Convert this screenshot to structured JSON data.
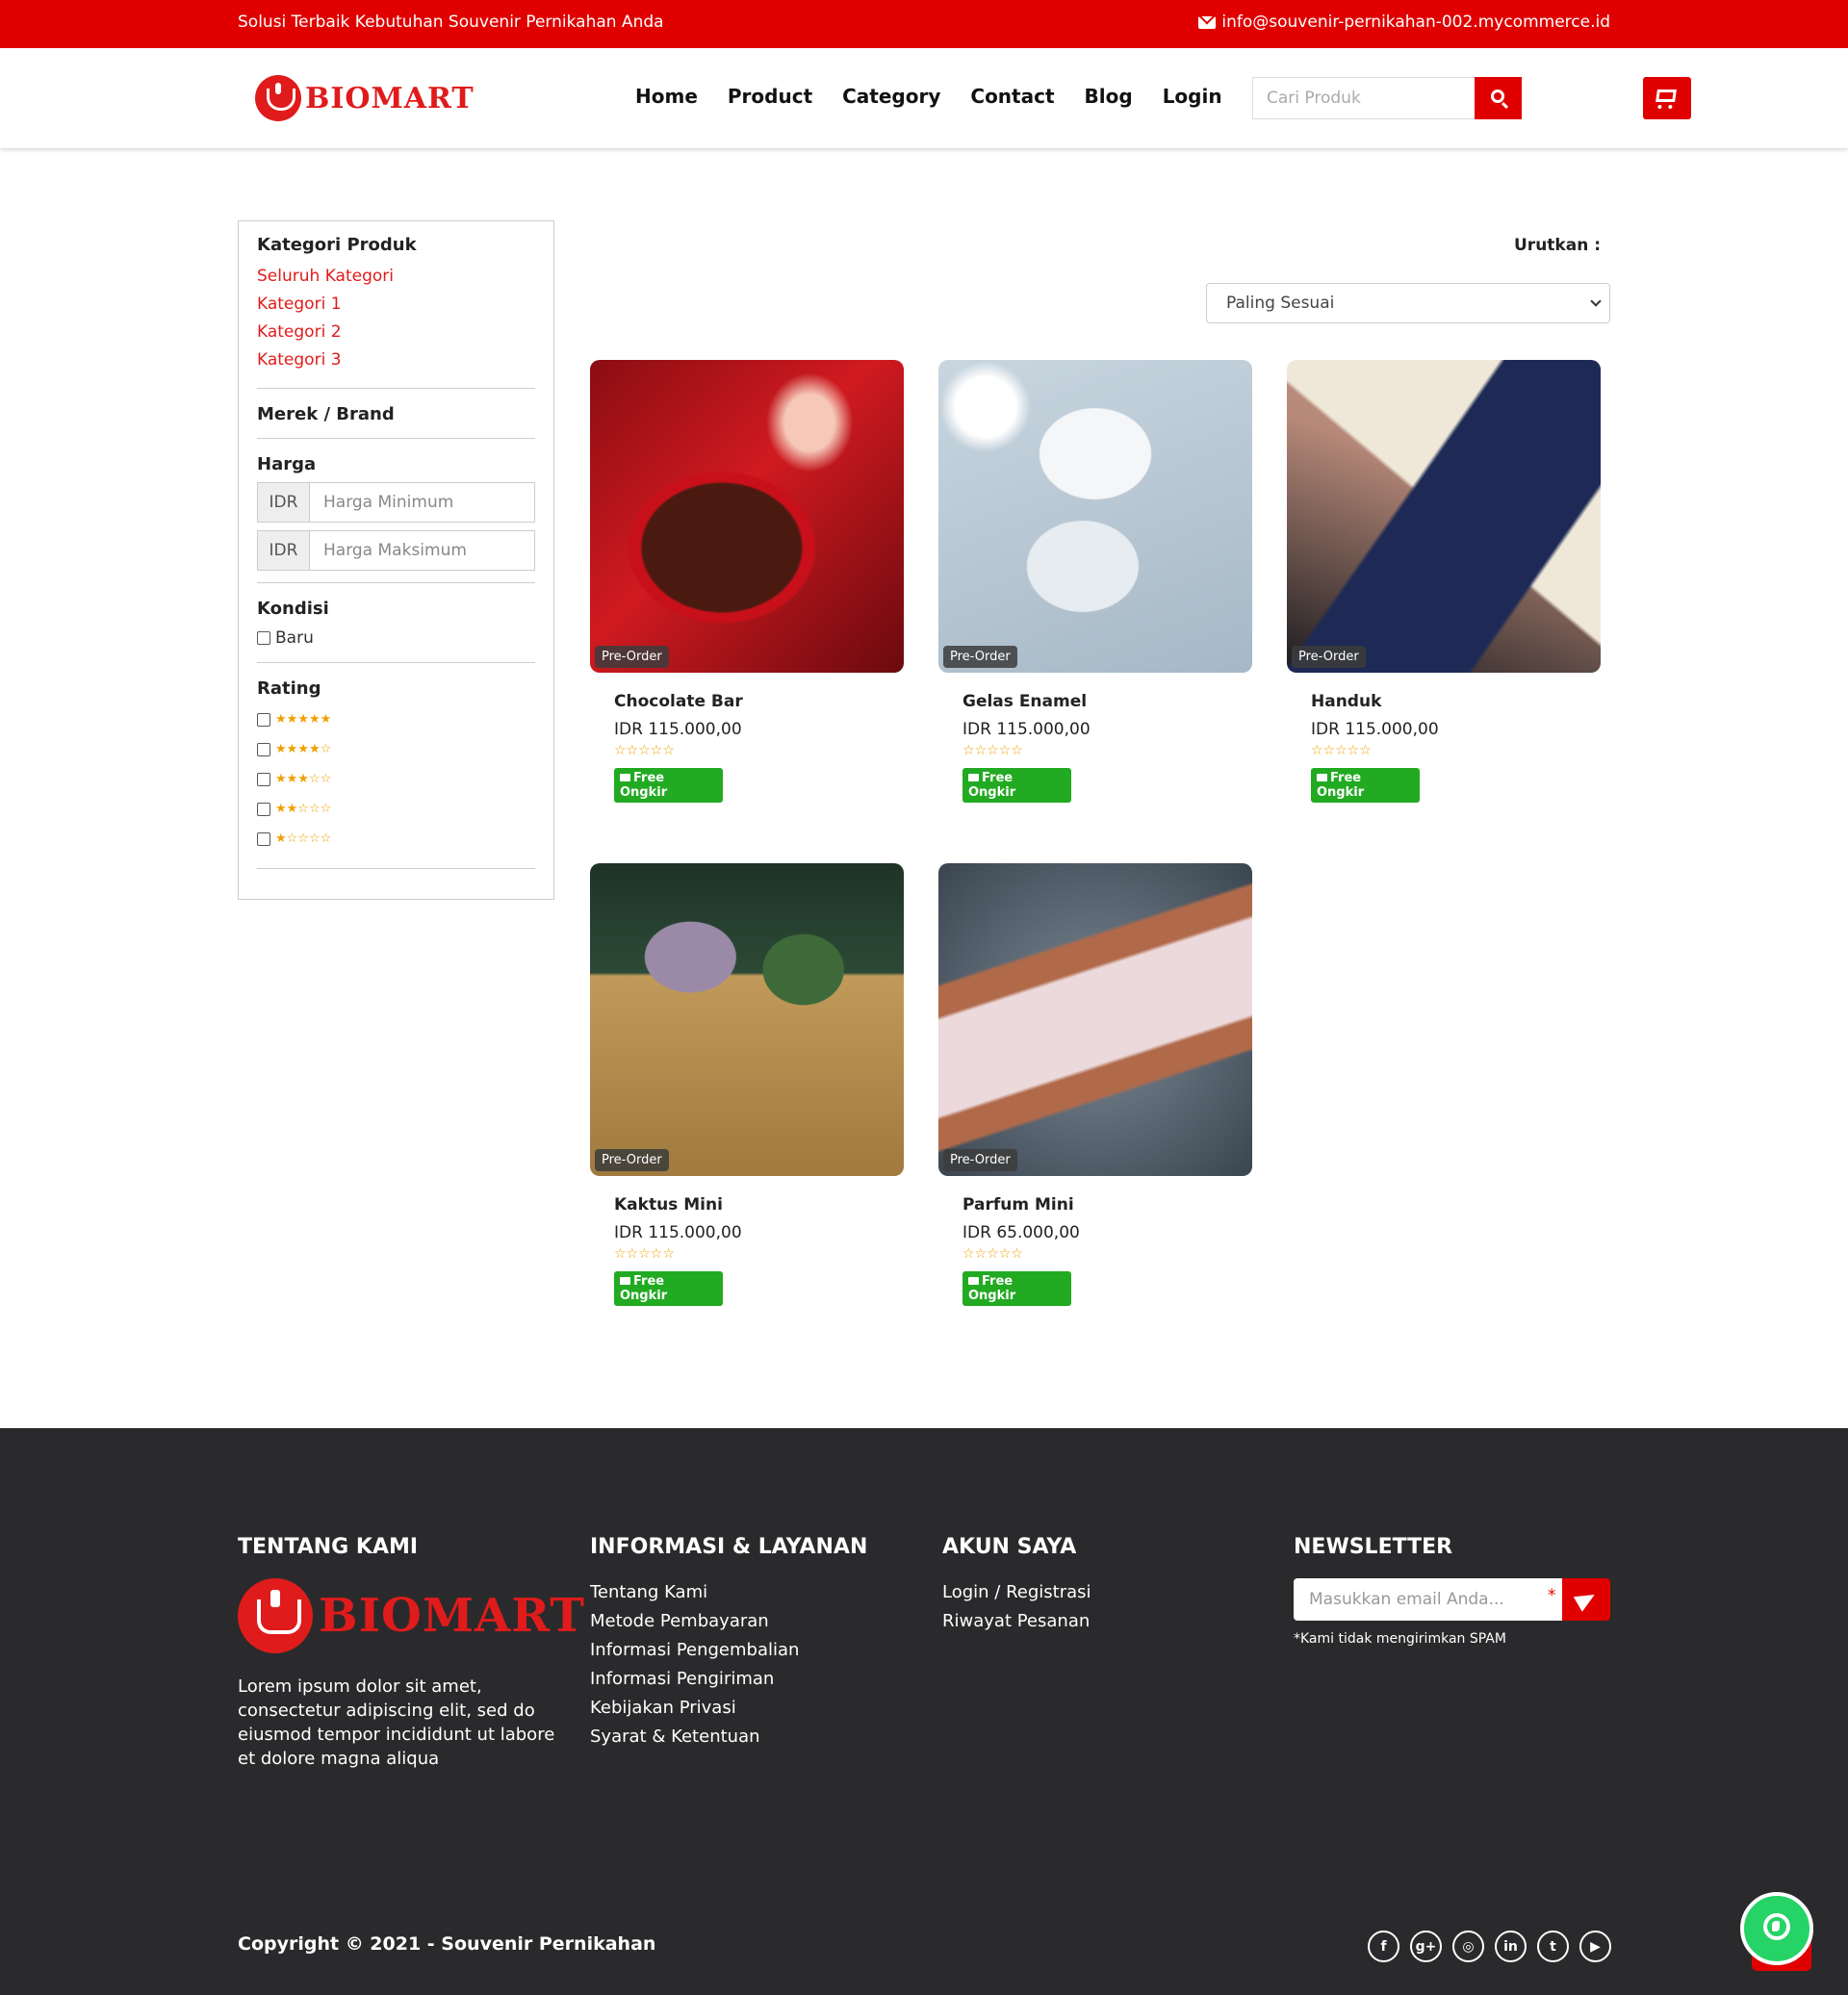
{
  "topbar": {
    "tagline": "Solusi Terbaik Kebutuhan Souvenir Pernikahan Anda",
    "email": "info@souvenir-pernikahan-002.mycommerce.id"
  },
  "header": {
    "logo_text": "BIOMART",
    "nav": [
      "Home",
      "Product",
      "Category",
      "Contact",
      "Blog",
      "Login"
    ],
    "search_placeholder": "Cari Produk"
  },
  "sidebar": {
    "category_title": "Kategori Produk",
    "categories": [
      "Seluruh Kategori",
      "Kategori 1",
      "Kategori 2",
      "Kategori 3"
    ],
    "brand_title": "Merek / Brand",
    "price_title": "Harga",
    "currency": "IDR",
    "price_min_placeholder": "Harga Minimum",
    "price_max_placeholder": "Harga Maksimum",
    "condition_title": "Kondisi",
    "condition_option": "Baru",
    "rating_title": "Rating",
    "rating_options": [
      "★★★★★",
      "★★★★☆",
      "★★★☆☆",
      "★★☆☆☆",
      "★☆☆☆☆"
    ]
  },
  "sort": {
    "label": "Urutkan :",
    "selected": "Paling Sesuai"
  },
  "products": [
    {
      "name": "Chocolate Bar",
      "price": "IDR 115.000,00",
      "rating": "☆☆☆☆☆",
      "badge": "Pre-Order",
      "shipping": "Free Ongkir"
    },
    {
      "name": "Gelas Enamel",
      "price": "IDR 115.000,00",
      "rating": "☆☆☆☆☆",
      "badge": "Pre-Order",
      "shipping": "Free Ongkir"
    },
    {
      "name": "Handuk",
      "price": "IDR 115.000,00",
      "rating": "☆☆☆☆☆",
      "badge": "Pre-Order",
      "shipping": "Free Ongkir"
    },
    {
      "name": "Kaktus Mini",
      "price": "IDR 115.000,00",
      "rating": "☆☆☆☆☆",
      "badge": "Pre-Order",
      "shipping": "Free Ongkir"
    },
    {
      "name": "Parfum Mini",
      "price": "IDR 65.000,00",
      "rating": "☆☆☆☆☆",
      "badge": "Pre-Order",
      "shipping": "Free Ongkir"
    }
  ],
  "footer": {
    "about_title": "TENTANG KAMI",
    "about_text": "Lorem ipsum dolor sit amet, consectetur adipiscing elit, sed do eiusmod tempor incididunt ut labore et dolore magna aliqua",
    "info_title": "INFORMASI & LAYANAN",
    "info_links": [
      "Tentang Kami",
      "Metode Pembayaran",
      "Informasi Pengembalian",
      "Informasi Pengiriman",
      "Kebijakan Privasi",
      "Syarat & Ketentuan"
    ],
    "account_title": "AKUN SAYA",
    "account_links": [
      "Login / Registrasi",
      "Riwayat Pesanan"
    ],
    "newsletter_title": "NEWSLETTER",
    "newsletter_placeholder": "Masukkan email Anda...",
    "newsletter_required": "*",
    "spam_note": "*Kami tidak mengirimkan SPAM",
    "copyright": "Copyright © 2021 - Souvenir Pernikahan",
    "socials": [
      "f",
      "g+",
      "◎",
      "in",
      "t",
      "▶"
    ]
  },
  "colors": {
    "brand_red": "#e00000",
    "footer_bg": "#2a2a2c",
    "free_shipping_green": "#22aa22",
    "star_orange": "#f0a000"
  }
}
